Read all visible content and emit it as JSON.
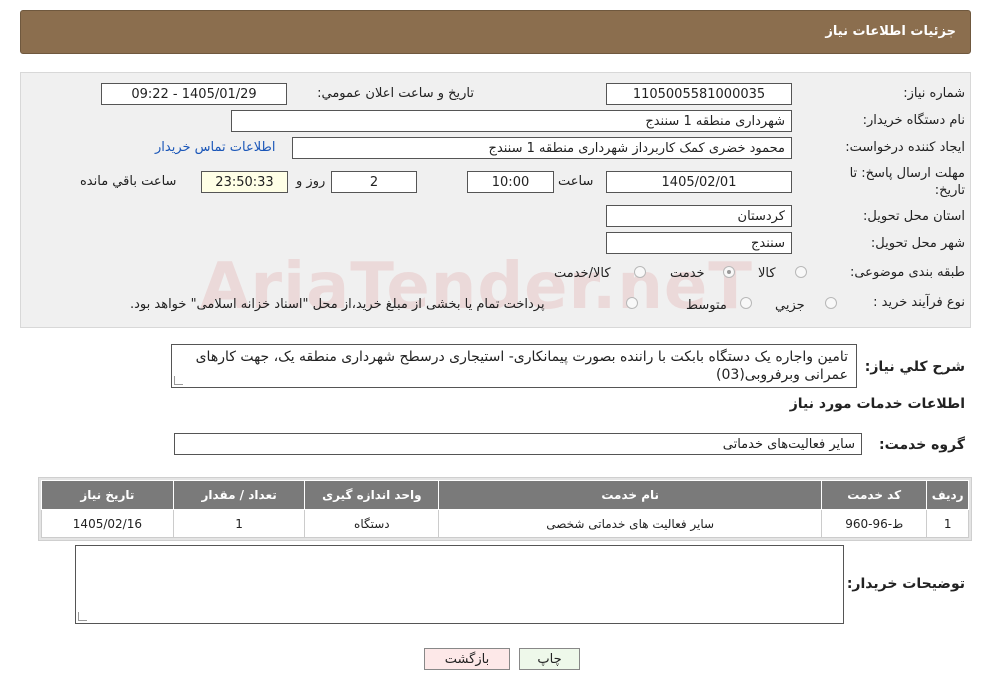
{
  "header": {
    "title": "جزئیات اطلاعات نیاز"
  },
  "form": {
    "need_number_label": "شماره نیاز:",
    "need_number": "1105005581000035",
    "announce_label": "تاریخ و ساعت اعلان عمومي:",
    "announce_value": "1405/01/29 - 09:22",
    "buyer_org_label": "نام دستگاه خريدار:",
    "buyer_org": "شهرداری منطقه 1 سنندج",
    "creator_label": "ايجاد كننده درخواست:",
    "creator": "محمود خضری کمک کاربرداز شهرداری منطقه 1 سنندج",
    "contact_link": "اطلاعات تماس خريدار",
    "deadline_label_1": "مهلت ارسال پاسخ: تا",
    "deadline_label_2": "تاريخ:",
    "deadline_date": "1405/02/01",
    "time_label": "ساعت",
    "deadline_time": "10:00",
    "days": "2",
    "days_label": "روز و",
    "remaining": "23:50:33",
    "remaining_label": "ساعت باقي مانده",
    "province_label": "استان محل تحويل:",
    "province": "کردستان",
    "city_label": "شهر محل تحويل:",
    "city": "سنندج",
    "category_label": "طبقه بندی موضوعی:",
    "category_options": [
      "کالا",
      "خدمت",
      "کالا/خدمت"
    ],
    "category_selected": "خدمت",
    "process_label": "نوع فرآيند خريد :",
    "process_options": [
      "جزيي",
      "متوسط"
    ],
    "process_note": "پرداخت تمام يا بخشی از مبلغ خريد،از محل \"اسناد خزانه اسلامی\" خواهد بود."
  },
  "watermark": "AriaTender.neT",
  "summary": {
    "label": "شرح كلي نياز:",
    "text": "تامین واجاره یک دستگاه بابکت با راننده بصورت پیمانکاری- استیجاری درسطح شهرداری منطقه یک، جهت کارهای عمرانی وبرفروبی(03)"
  },
  "services": {
    "section_title": "اطلاعات خدمات مورد نياز",
    "group_label": "گروه خدمت:",
    "group_value": "ساير فعاليت‌های خدماتی",
    "columns": [
      "رديف",
      "كد خدمت",
      "نام خدمت",
      "واحد اندازه گيری",
      "تعداد / مقدار",
      "تاريخ نياز"
    ],
    "rows": [
      [
        "1",
        "ط-96-960",
        "ساير فعاليت های خدماتی شخصی",
        "دستگاه",
        "1",
        "1405/02/16"
      ]
    ]
  },
  "buyer_notes": {
    "label": "توضيحات خريدار:",
    "text": ""
  },
  "buttons": {
    "print": "چاپ",
    "back": "بازگشت"
  }
}
